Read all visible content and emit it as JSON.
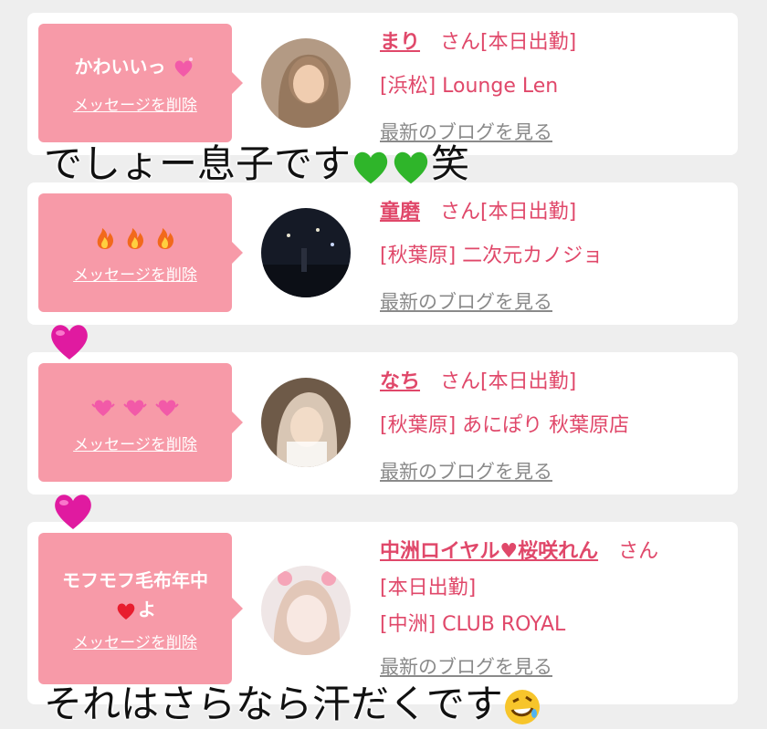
{
  "colors": {
    "accent": "#e0486a",
    "bubble": "#f79aa8",
    "muted": "#8a8a8a"
  },
  "cards": [
    {
      "message": "かわいいっ",
      "message_icons": [
        "sparkling-heart-icon"
      ],
      "delete_label": "メッセージを削除",
      "name": "まり",
      "san": "さん",
      "status": "[本日出勤]",
      "shop": "[浜松] Lounge Len",
      "blog": "最新のブログを見る"
    },
    {
      "message": "",
      "message_icons": [
        "fire-icon",
        "fire-icon",
        "fire-icon"
      ],
      "delete_label": "メッセージを削除",
      "name": "童磨",
      "san": "さん",
      "status": "[本日出勤]",
      "shop": "[秋葉原] 二次元カノジョ",
      "blog": "最新のブログを見る"
    },
    {
      "message": "",
      "message_icons": [
        "heartbeat-icon",
        "heartbeat-icon",
        "heartbeat-icon"
      ],
      "delete_label": "メッセージを削除",
      "name": "なち",
      "san": "さん",
      "status": "[本日出勤]",
      "shop": "[秋葉原] あにぽり 秋葉原店",
      "blog": "最新のブログを見る"
    },
    {
      "message": "モフモフ毛布年中",
      "message_line2": "よ",
      "message_icons": [
        "red-heart-icon"
      ],
      "delete_label": "メッセージを削除",
      "name": "中洲ロイヤル♥桜咲れん",
      "san": "さん",
      "status": "[本日出勤]",
      "shop": "[中洲] CLUB ROYAL",
      "blog": "最新のブログを見る"
    }
  ],
  "captions": {
    "top": "でしょー息子です",
    "top_icons": [
      "green-heart-icon",
      "green-heart-icon"
    ],
    "top_suffix": "笑",
    "bottom": "それはさらなら汗だくです",
    "bottom_icons": [
      "rofl-face-icon"
    ]
  },
  "overlay_icons": [
    "magenta-heart-icon",
    "magenta-heart-icon"
  ]
}
